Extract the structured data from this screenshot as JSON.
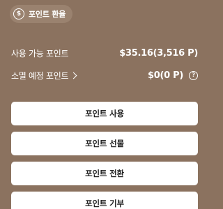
{
  "exchange": {
    "icon": "dollar-coin-icon",
    "icon_glyph": "$",
    "label": "포인트 환율"
  },
  "points": {
    "available": {
      "label": "사용 가능 포인트",
      "value": "$35.16(3,516 P)"
    },
    "expiring": {
      "label": "소멸 예정 포인트",
      "value": "$0(0 P)",
      "help_glyph": "?"
    }
  },
  "actions": {
    "use_label": "포인트 사용",
    "gift_label": "포인트 선물",
    "convert_label": "포인트 전환",
    "donate_label": "포인트 기부"
  },
  "colors": {
    "background": "#8b725f",
    "pill_background": "#9a826f",
    "button_background": "#ffffff",
    "button_text": "#222222"
  }
}
